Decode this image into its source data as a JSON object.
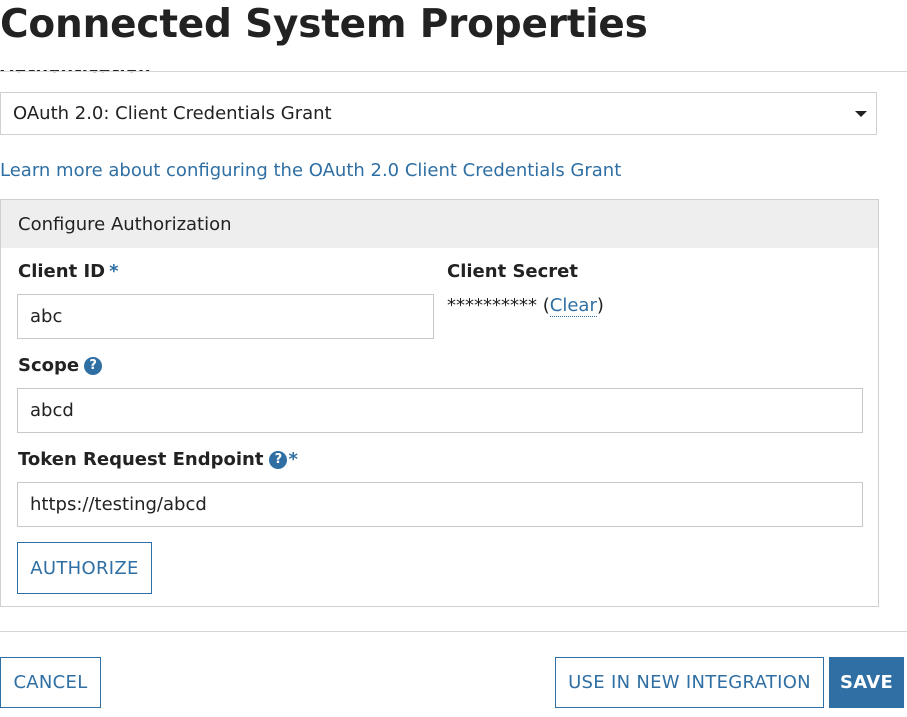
{
  "header": {
    "title": "Connected System Properties"
  },
  "authentication": {
    "label": "Authentication",
    "selected": "OAuth 2.0: Client Credentials Grant",
    "learn_more_link": "Learn more about configuring the OAuth 2.0 Client Credentials Grant"
  },
  "configure": {
    "header": "Configure Authorization",
    "client_id": {
      "label": "Client ID",
      "required": "*",
      "value": "abc"
    },
    "client_secret": {
      "label": "Client Secret",
      "masked": "**********",
      "open_paren": "(",
      "clear_label": "Clear",
      "close_paren": ")"
    },
    "scope": {
      "label": "Scope",
      "help": "?",
      "value": "abcd"
    },
    "token_endpoint": {
      "label": "Token Request Endpoint",
      "help": "?",
      "required": "*",
      "value": "https://testing/abcd"
    },
    "authorize_label": "AUTHORIZE"
  },
  "footer": {
    "cancel_label": "CANCEL",
    "use_in_new_integration_label": "USE IN NEW INTEGRATION",
    "save_label": "SAVE"
  },
  "colors": {
    "accent": "#2f6fa3",
    "header_bg": "#eeeeee",
    "border": "#d0d0d0"
  },
  "icons": {
    "dropdown": "chevron-down-icon",
    "help": "help-circle-icon"
  }
}
